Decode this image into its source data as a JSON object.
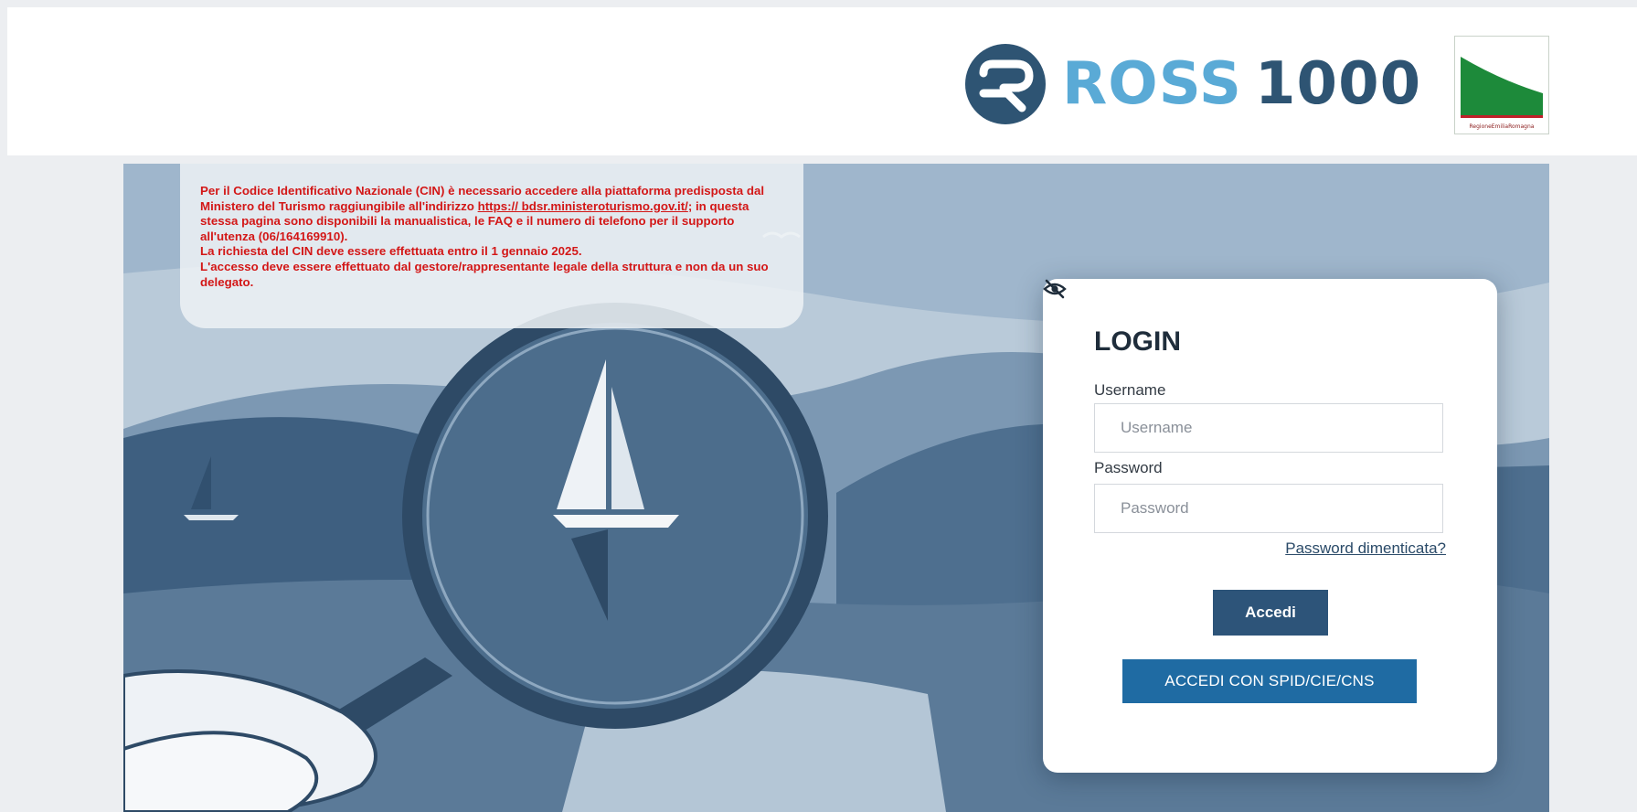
{
  "header": {
    "brand_name": "ROSS",
    "brand_number": "1000",
    "region_logo_caption": "RegioneEmiliaRomagna"
  },
  "notice": {
    "line1": "Per il Codice Identificativo Nazionale (CIN) è necessario accedere alla piattaforma predisposta dal Ministero del Turismo raggiungibile all'indirizzo ",
    "link_text": "https:// bdsr.ministeroturismo.gov.it/",
    "line2": "; in questa stessa pagina sono disponibili la manualistica, le FAQ e il numero di telefono per il supporto all'utenza (06/164169910).",
    "line3": "La richiesta del CIN deve essere effettuata entro il 1 gennaio 2025.",
    "line4": "L'accesso deve essere effettuato dal gestore/rappresentante legale della struttura e non da un suo delegato."
  },
  "login": {
    "title": "LOGIN",
    "username_label": "Username",
    "username_placeholder": "Username",
    "username_value": "",
    "password_label": "Password",
    "password_placeholder": "Password",
    "password_value": "",
    "forgot_link": "Password dimenticata?",
    "submit_label": "Accedi",
    "spid_label": "ACCEDI CON SPID/CIE/CNS"
  },
  "icons": {
    "eye": "eye-slash-icon",
    "brand": "ross-logo-icon"
  },
  "colors": {
    "brand_light": "#5aaad6",
    "brand_dark": "#2e5473",
    "notice_text": "#d31717",
    "primary_button": "#2d5479",
    "spid_button": "#1f6ba3"
  }
}
